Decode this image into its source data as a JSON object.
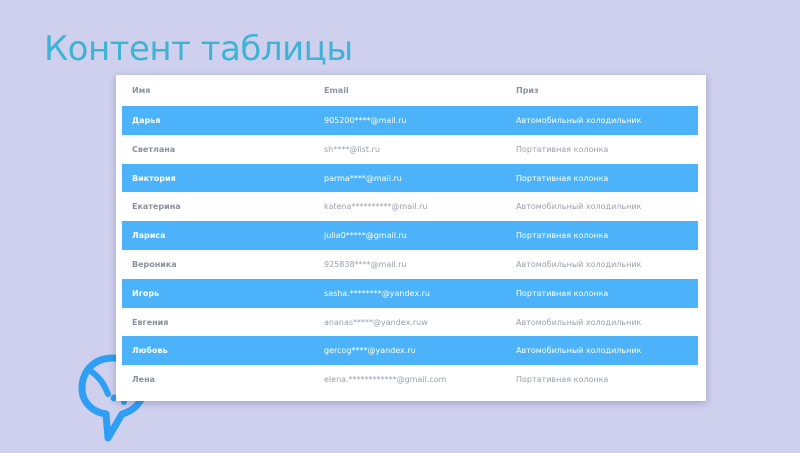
{
  "slide": {
    "title": "Контент таблицы"
  },
  "table": {
    "headers": {
      "name": "Имя",
      "email": "Email",
      "prize": "Приз"
    },
    "rows": [
      {
        "name": "Дарья",
        "email": "905200****@mail.ru",
        "prize": "Автомобильный холодильник",
        "highlighted": true
      },
      {
        "name": "Светлана",
        "email": "sh****@list.ru",
        "prize": "Портативная колонка",
        "highlighted": false
      },
      {
        "name": "Виктория",
        "email": "parma****@mail.ru",
        "prize": "Портативная колонка",
        "highlighted": true
      },
      {
        "name": "Екатерина",
        "email": "katena**********@mail.ru",
        "prize": "Автомобильный холодильник",
        "highlighted": false
      },
      {
        "name": "Лариса",
        "email": "julia0*****@gmail.ru",
        "prize": "Портативная колонка",
        "highlighted": true
      },
      {
        "name": "Вероника",
        "email": "925838****@mail.ru",
        "prize": "Автомобильный холодильник",
        "highlighted": false
      },
      {
        "name": "Игорь",
        "email": "sasha.********@yandex.ru",
        "prize": "Портативная колонка",
        "highlighted": true
      },
      {
        "name": "Евгения",
        "email": "ananas*****@yandex.ruw",
        "prize": "Автомобильный холодильник",
        "highlighted": false
      },
      {
        "name": "Любовь",
        "email": "gercog****@yandex.ru",
        "prize": "Автомобильный холодильник",
        "highlighted": true
      },
      {
        "name": "Лена",
        "email": "elena.************@gmail.com",
        "prize": "Портативная колонка",
        "highlighted": false
      }
    ]
  },
  "colors": {
    "background": "#cfd0ee",
    "title": "#3fb3d6",
    "row_highlight": "#4cb3fb",
    "logo": "#2f9ef5"
  },
  "icons": {
    "logo": "speech-bubble-chat-logo"
  }
}
